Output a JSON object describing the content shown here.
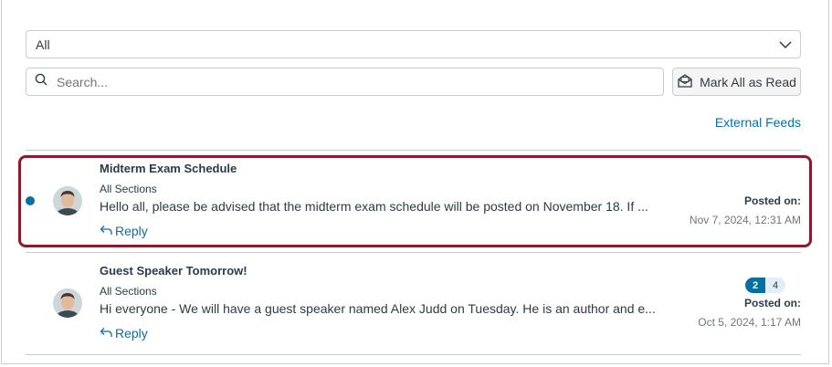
{
  "filter": {
    "selected": "All"
  },
  "search": {
    "placeholder": "Search..."
  },
  "toolbar": {
    "mark_all_label": "Mark All as Read"
  },
  "links": {
    "external_feeds": "External Feeds"
  },
  "colors": {
    "accent": "#0770a3",
    "highlight_border": "#8b1a2b",
    "badge_bg": "#e1eef6"
  },
  "announcements": [
    {
      "title": "Midterm Exam Schedule",
      "sections": "All Sections",
      "excerpt": "Hello all, please be advised that the midterm exam schedule will be posted on November 18. If ...",
      "reply_label": "Reply",
      "posted_label": "Posted on:",
      "posted_date": "Nov 7, 2024, 12:31 AM",
      "unread": true
    },
    {
      "title": "Guest Speaker Tomorrow!",
      "sections": "All Sections",
      "excerpt": "Hi everyone - We will have a guest speaker named Alex Judd on Tuesday. He is an author and e...",
      "reply_label": "Reply",
      "posted_label": "Posted on:",
      "posted_date": "Oct 5, 2024, 1:17 AM",
      "unread_replies": "2",
      "total_replies": "4"
    }
  ]
}
